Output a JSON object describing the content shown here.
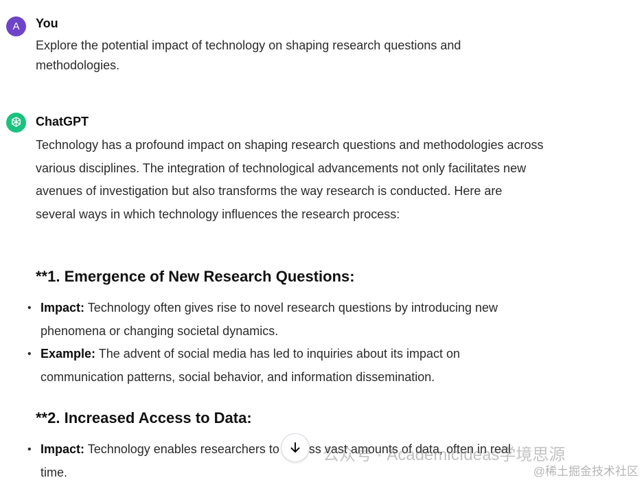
{
  "user_message": {
    "avatar_initial": "A",
    "author": "You",
    "text": "Explore the potential impact of technology on shaping research questions and methodologies."
  },
  "assistant_message": {
    "author": "ChatGPT",
    "intro": "Technology has a profound impact on shaping research questions and methodologies across various disciplines. The integration of technological advancements not only facilitates new avenues of investigation but also transforms the way research is conducted. Here are several ways in which technology influences the research process:",
    "sections": [
      {
        "heading": "**1. Emergence of New Research Questions:",
        "bullets": [
          {
            "label": "Impact:",
            "text": " Technology often gives rise to novel research questions by introducing new phenomena or changing societal dynamics."
          },
          {
            "label": "Example:",
            "text": " The advent of social media has led to inquiries about its impact on communication patterns, social behavior, and information dissemination."
          }
        ]
      },
      {
        "heading": "**2. Increased Access to Data:",
        "bullets": [
          {
            "label": "Impact:",
            "text": " Technology enables researchers to access vast amounts of data, often in real time."
          }
        ]
      }
    ]
  },
  "scroll_button_icon": "arrow-down-icon",
  "watermark": {
    "main": "公众号 · AcademicIdeas学境思源",
    "corner": "@稀土掘金技术社区"
  },
  "colors": {
    "user_avatar": "#6e44c9",
    "assistant_avatar": "#19c37d"
  }
}
